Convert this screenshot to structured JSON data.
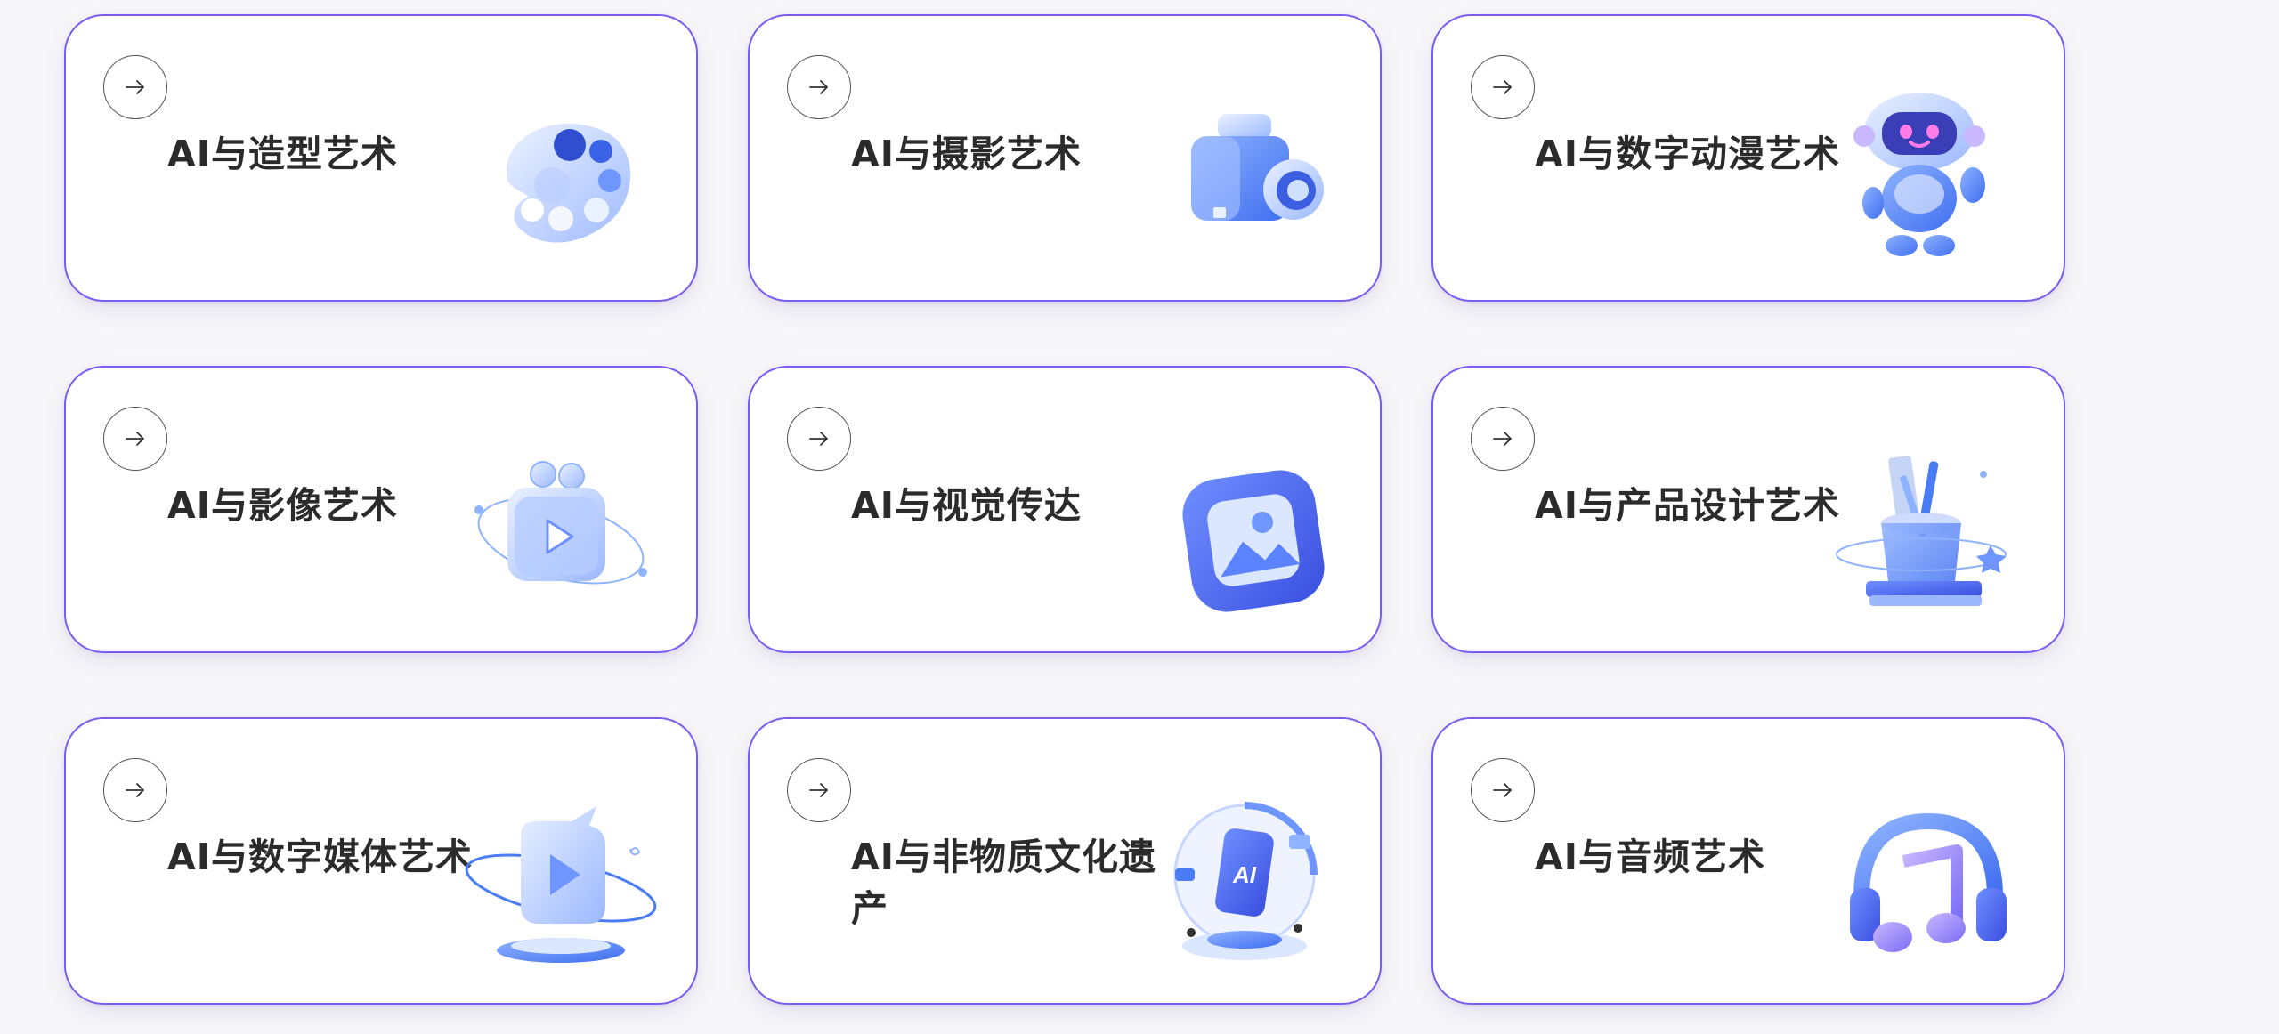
{
  "cards": [
    {
      "title": "AI与造型艺术",
      "icon": "palette-icon"
    },
    {
      "title": "AI与摄影艺术",
      "icon": "video-camera-icon"
    },
    {
      "title": "AI与数字动漫艺术",
      "icon": "robot-icon"
    },
    {
      "title": "AI与影像艺术",
      "icon": "film-camera-icon"
    },
    {
      "title": "AI与视觉传达",
      "icon": "image-icon"
    },
    {
      "title": "AI与产品设计艺术",
      "icon": "pencil-cup-icon"
    },
    {
      "title": "AI与数字媒体艺术",
      "icon": "play-bubble-icon"
    },
    {
      "title": "AI与非物质文化遗产",
      "icon": "ai-phone-icon",
      "badge": "AI"
    },
    {
      "title": "AI与音频艺术",
      "icon": "headphones-music-icon"
    }
  ],
  "colors": {
    "border": "#7b5cf0",
    "accent_blue": "#4a7df5",
    "text": "#2b2b2b"
  }
}
